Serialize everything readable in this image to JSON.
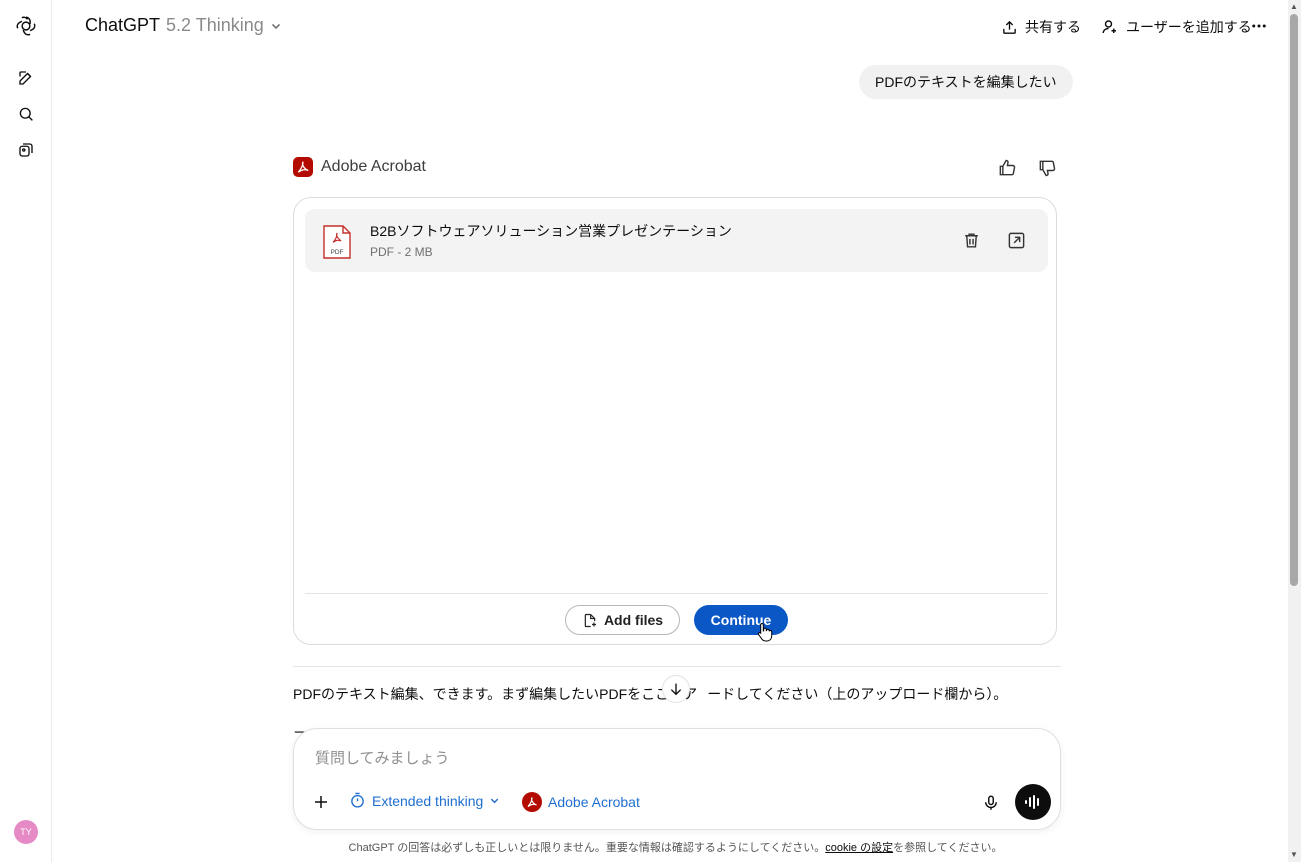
{
  "header": {
    "model_name": "ChatGPT",
    "model_version": "5.2 Thinking",
    "share_label": "共有する",
    "add_user_label": "ユーザーを追加する"
  },
  "sidebar": {
    "avatar_initials": "TY",
    "items": [
      {
        "icon": "new-chat-icon"
      },
      {
        "icon": "search-icon"
      },
      {
        "icon": "library-icon"
      }
    ]
  },
  "chat": {
    "user_message": "PDFのテキストを編集したい",
    "app_name": "Adobe Acrobat",
    "file": {
      "name": "B2Bソフトウェアソリューション営業プレゼンテーション",
      "meta": "PDF - 2 MB",
      "icon_label": "PDF"
    },
    "add_files_label": "Add files",
    "continue_label": "Continue",
    "assistant_message": "PDFのテキスト編集、できます。まず編集したいPDFをここにア",
    "assistant_message_tail": "ードしてください（上のアップロード欄から）。",
    "partial_next_line": "ア"
  },
  "composer": {
    "placeholder": "質問してみましょう",
    "thinking_label": "Extended thinking",
    "app_label": "Adobe Acrobat"
  },
  "footer": {
    "disclaimer": "ChatGPT の回答は必ずしも正しいとは限りません。重要な情報は確認するようにしてください。",
    "cookie_link": "cookie の設定",
    "suffix": "を参照してください。"
  },
  "colors": {
    "accent_blue": "#0b57c6",
    "acrobat_red": "#b30b00",
    "link_blue": "#1f6fd1"
  }
}
